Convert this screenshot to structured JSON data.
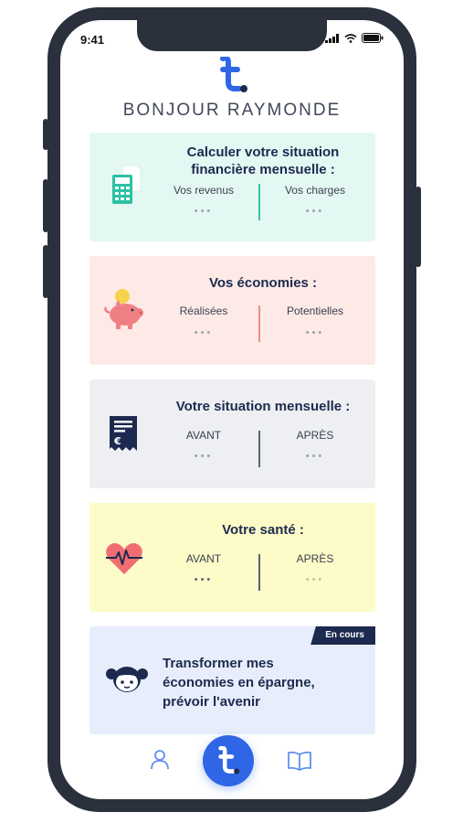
{
  "status": {
    "time": "9:41"
  },
  "header": {
    "greeting": "BONJOUR RAYMONDE"
  },
  "cards": {
    "calcul": {
      "title_line1": "Calculer votre situation",
      "title_line2": "financière mensuelle :",
      "left_label": "Vos revenus",
      "right_label": "Vos charges",
      "left_value": "•••",
      "right_value": "•••",
      "color": "#e4f8f3",
      "divider_color": "#35c4a0",
      "icon": "calculator-icon"
    },
    "economies": {
      "title": "Vos économies :",
      "left_label": "Réalisées",
      "right_label": "Potentielles",
      "left_value": "•••",
      "right_value": "•••",
      "color": "#fdeae7",
      "divider_color": "#f08a8a",
      "icon": "piggy-bank-icon"
    },
    "situation": {
      "title": "Votre situation mensuelle :",
      "left_label": "AVANT",
      "right_label": "APRÈS",
      "left_value": "•••",
      "right_value": "•••",
      "color": "#eeeff2",
      "divider_color": "#5c6275",
      "icon": "euro-receipt-icon"
    },
    "sante": {
      "title": "Votre santé :",
      "left_label": "AVANT",
      "right_label": "APRÈS",
      "left_value": "•••",
      "right_value": "•••",
      "color": "#fdfbc8",
      "divider_color": "#5c6275",
      "icon": "heart-pulse-icon"
    },
    "epargne": {
      "title_line1": "Transformer mes",
      "title_line2": "économies en épargne,",
      "title_line3": "prévoir l'avenir",
      "badge": "En cours",
      "color": "#e7edfb",
      "icon": "child-face-icon"
    }
  },
  "nav": {
    "left_icon": "profile-icon",
    "center_icon": "home-logo-icon",
    "right_icon": "book-icon",
    "accent": "#2f66e6"
  }
}
